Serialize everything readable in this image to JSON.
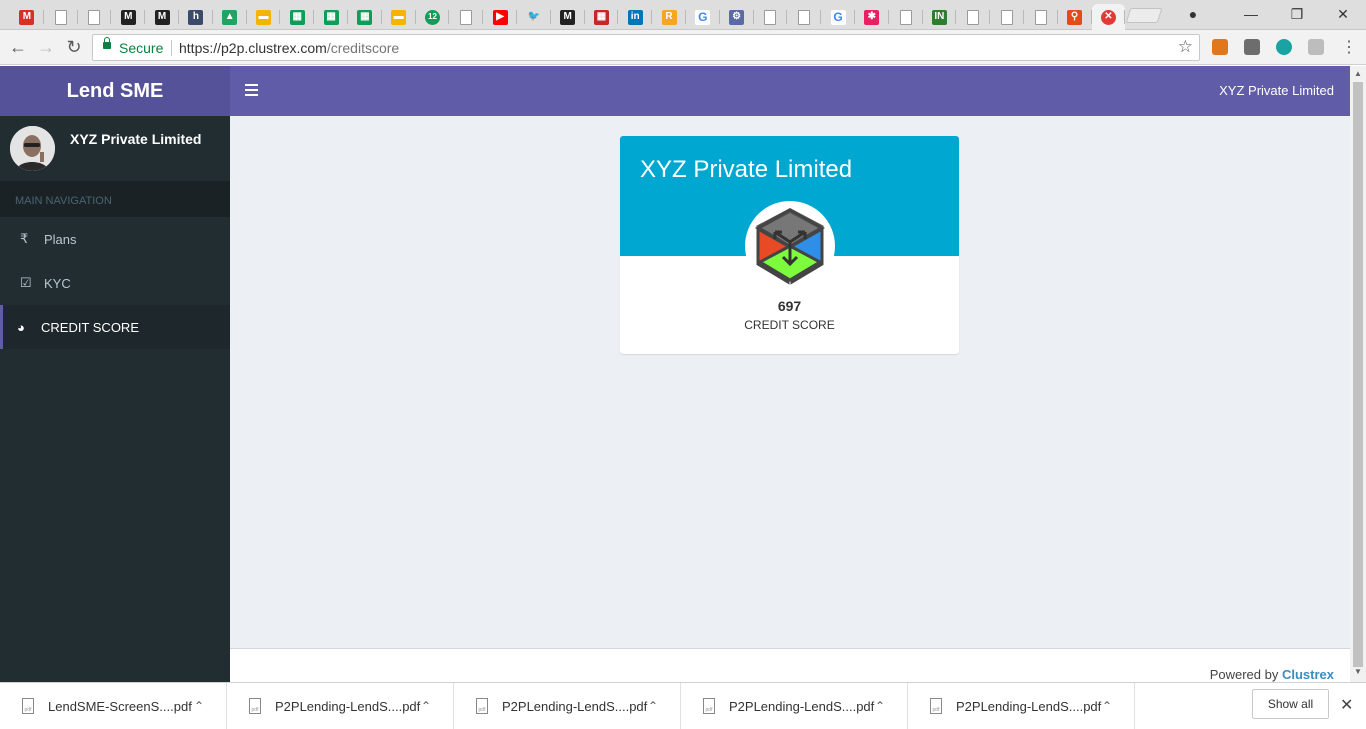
{
  "browser": {
    "tabs": [
      {
        "icon": "gmail-icon",
        "label": "",
        "color": "#d93025",
        "glyph": "M"
      },
      {
        "icon": "document-icon",
        "label": "",
        "color": "",
        "glyph": ""
      },
      {
        "icon": "document-icon",
        "label": "",
        "color": "",
        "glyph": ""
      },
      {
        "icon": "medium-icon",
        "label": "",
        "color": "#222222",
        "glyph": "M"
      },
      {
        "icon": "medium-icon",
        "label": "",
        "color": "#222222",
        "glyph": "M"
      },
      {
        "icon": "hashnode-icon",
        "label": "",
        "color": "#3d4b6b",
        "glyph": "h"
      },
      {
        "icon": "google-drive-icon",
        "label": "",
        "color": "#1fa463",
        "glyph": "▲"
      },
      {
        "icon": "google-slides-icon",
        "label": "",
        "color": "#f4b400",
        "glyph": "▬"
      },
      {
        "icon": "google-sheets-icon",
        "label": "",
        "color": "#0f9d58",
        "glyph": "▦"
      },
      {
        "icon": "google-sheets-icon",
        "label": "",
        "color": "#0f9d58",
        "glyph": "▦"
      },
      {
        "icon": "google-sheets-icon",
        "label": "",
        "color": "#0f9d58",
        "glyph": "▦"
      },
      {
        "icon": "google-slides-icon",
        "label": "",
        "color": "#f4b400",
        "glyph": "▬"
      },
      {
        "icon": "hangouts-icon",
        "label": "12",
        "color": "#0f9d58",
        "glyph": "12"
      },
      {
        "icon": "document-icon",
        "label": "",
        "color": "",
        "glyph": ""
      },
      {
        "icon": "youtube-icon",
        "label": "",
        "color": "#ff0000",
        "glyph": "▶"
      },
      {
        "icon": "twitter-icon",
        "label": "",
        "color": "#1da1f2",
        "glyph": "🐦"
      },
      {
        "icon": "medium-icon",
        "label": "",
        "color": "#222222",
        "glyph": "M"
      },
      {
        "icon": "news-icon",
        "label": "",
        "color": "#c62828",
        "glyph": "▦"
      },
      {
        "icon": "linkedin-icon",
        "label": "",
        "color": "#0077b5",
        "glyph": "in"
      },
      {
        "icon": "r-icon",
        "label": "",
        "color": "#f5a623",
        "glyph": "R"
      },
      {
        "icon": "google-icon",
        "label": "",
        "color": "#4285f4",
        "glyph": "G"
      },
      {
        "icon": "gear-icon",
        "label": "",
        "color": "#5b6aa5",
        "glyph": "⚙"
      },
      {
        "icon": "document-icon",
        "label": "",
        "color": "",
        "glyph": ""
      },
      {
        "icon": "document-icon",
        "label": "",
        "color": "",
        "glyph": ""
      },
      {
        "icon": "google-icon",
        "label": "",
        "color": "#4285f4",
        "glyph": "G"
      },
      {
        "icon": "colorful-dots-icon",
        "label": "",
        "color": "#e91e63",
        "glyph": "✱"
      },
      {
        "icon": "document-icon",
        "label": "",
        "color": "",
        "glyph": ""
      },
      {
        "icon": "india-gov-icon",
        "label": "",
        "color": "#2e7d32",
        "glyph": "IN"
      },
      {
        "icon": "document-icon",
        "label": "",
        "color": "",
        "glyph": ""
      },
      {
        "icon": "document-icon",
        "label": "",
        "color": "",
        "glyph": ""
      },
      {
        "icon": "document-icon",
        "label": "",
        "color": "",
        "glyph": ""
      },
      {
        "icon": "map-pin-icon",
        "label": "",
        "color": "#e64a19",
        "glyph": "⚲"
      },
      {
        "icon": "error-icon",
        "label": "",
        "color": "#e53935",
        "glyph": "✕",
        "active": true
      }
    ],
    "address": {
      "secure_label": "Secure",
      "url_host": "https://p2p.clustrex.com",
      "url_path": "/creditscore"
    }
  },
  "app": {
    "brand": "Lend SME",
    "company_name": "XYZ Private Limited",
    "sidebar": {
      "user_name": "XYZ Private Limited",
      "nav_header": "MAIN NAVIGATION",
      "items": [
        {
          "label": "Plans",
          "icon": "rupee-icon",
          "glyph": "₹"
        },
        {
          "label": "KYC",
          "icon": "check-square-icon",
          "glyph": "☑"
        },
        {
          "label": "CREDIT SCORE",
          "icon": "pie-chart-icon",
          "glyph": "◕"
        }
      ]
    },
    "card": {
      "title": "XYZ Private Limited",
      "score": "697",
      "score_label": "CREDIT SCORE",
      "header_color": "#00a7d0"
    },
    "footer": {
      "powered_prefix": "Powered by ",
      "powered_brand": "Clustrex"
    },
    "colors": {
      "primary": "#605ca8",
      "sidebar": "#222d32",
      "content_bg": "#ecf0f5"
    }
  },
  "downloads": {
    "items": [
      {
        "name": "LendSME-ScreenS....pdf"
      },
      {
        "name": "P2PLending-LendS....pdf"
      },
      {
        "name": "P2PLending-LendS....pdf"
      },
      {
        "name": "P2PLending-LendS....pdf"
      },
      {
        "name": "P2PLending-LendS....pdf"
      }
    ],
    "show_all": "Show all"
  }
}
